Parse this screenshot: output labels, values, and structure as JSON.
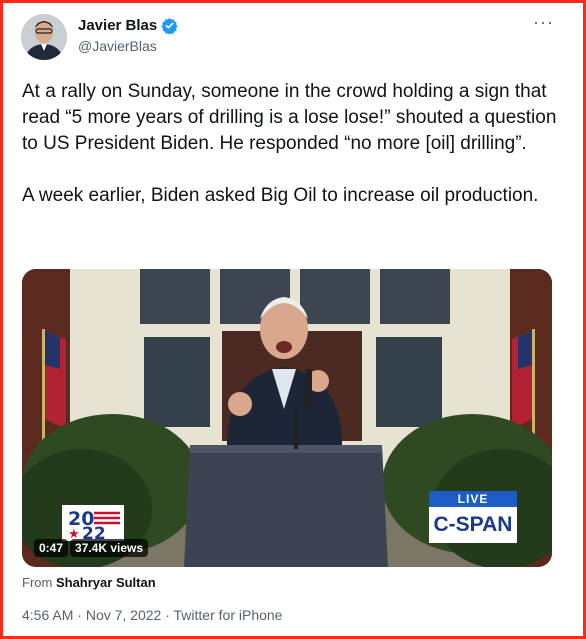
{
  "author": {
    "name": "Javier Blas",
    "handle": "@JavierBlas",
    "verified_color": "#1d9bf0"
  },
  "menu": {
    "more_glyph": "···"
  },
  "tweet": {
    "paragraph1": "At a rally on Sunday, someone in the crowd holding a sign that read “5 more years of drilling is a lose lose!” shouted a question to US President Biden. He responded “no more [oil] drilling”.",
    "paragraph2": "A week earlier, Biden asked Big Oil to increase oil production."
  },
  "video": {
    "duration": "0:47",
    "views": "37.4K views",
    "live_label": "LIVE",
    "network_label": "C-SPAN",
    "logo_text": "20 22"
  },
  "attribution": {
    "prefix": "From",
    "source": "Shahryar Sultan"
  },
  "meta": {
    "time": "4:56 AM",
    "date": "Nov 7, 2022",
    "client": "Twitter for iPhone",
    "separator": "·"
  },
  "colors": {
    "border": "#ff2a1a",
    "secondary_text": "#536471",
    "primary_text": "#0f1419"
  }
}
